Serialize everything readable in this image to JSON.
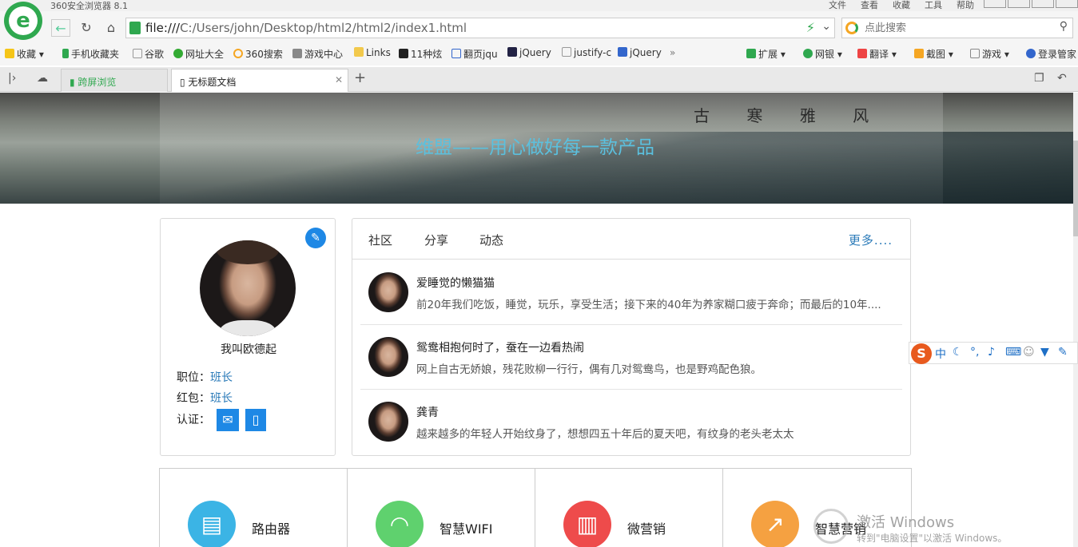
{
  "browser": {
    "title": "360安全浏览器 8.1",
    "menus": [
      "文件",
      "查看",
      "收藏",
      "工具",
      "帮助"
    ],
    "url_prefix": "file:///",
    "url_rest": "C:/Users/john/Desktop/html2/html2/index1.html",
    "search_placeholder": "点此搜索",
    "bookmarks": [
      "收藏",
      "手机收藏夹",
      "谷歌",
      "网址大全",
      "360搜索",
      "游戏中心",
      "Links",
      "11种炫",
      "翻页jqu",
      "jQuery",
      "justify-c",
      "jQuery"
    ],
    "extensions": [
      "扩展",
      "网银",
      "翻译",
      "截图",
      "游戏",
      "登录管家"
    ],
    "tabs": [
      "跨屏浏览",
      "无标题文档"
    ]
  },
  "banner": {
    "heading": "维盟——用心做好每一款产品",
    "calligraphy": "古 寒 雅 风"
  },
  "profile": {
    "name": "我叫欧德起",
    "position_label": "职位：",
    "position_value": "班长",
    "redpacket_label": "红包：",
    "redpacket_value": "班长",
    "verify_label": "认证："
  },
  "feed": {
    "tabs": [
      "社区",
      "分享",
      "动态"
    ],
    "more": "更多....",
    "items": [
      {
        "title": "爱睡觉的懒猫猫",
        "desc": "前20年我们吃饭，睡觉，玩乐，享受生活；接下来的40年为养家糊口疲于奔命；而最后的10年...."
      },
      {
        "title": "鸳鸯相抱何时了，蚕在一边看热闹",
        "desc": "网上自古无娇娘，残花败柳一行行，偶有几对鸳鸯鸟，也是野鸡配色狼。"
      },
      {
        "title": "龚青",
        "desc": "越来越多的年轻人开始纹身了，想想四五十年后的夏天吧，有纹身的老头老太太"
      }
    ]
  },
  "features": [
    {
      "label": "路由器",
      "color": "#3bb4e5"
    },
    {
      "label": "智慧WIFI",
      "color": "#5fd16e"
    },
    {
      "label": "微营销",
      "color": "#ee4b4b"
    },
    {
      "label": "智慧营销",
      "color": "#f5a141"
    }
  ],
  "ime": {
    "logo": "S",
    "lang": "中"
  },
  "watermark": {
    "line1": "激活 Windows",
    "line2": "转到\"电脑设置\"以激活 Windows。"
  }
}
